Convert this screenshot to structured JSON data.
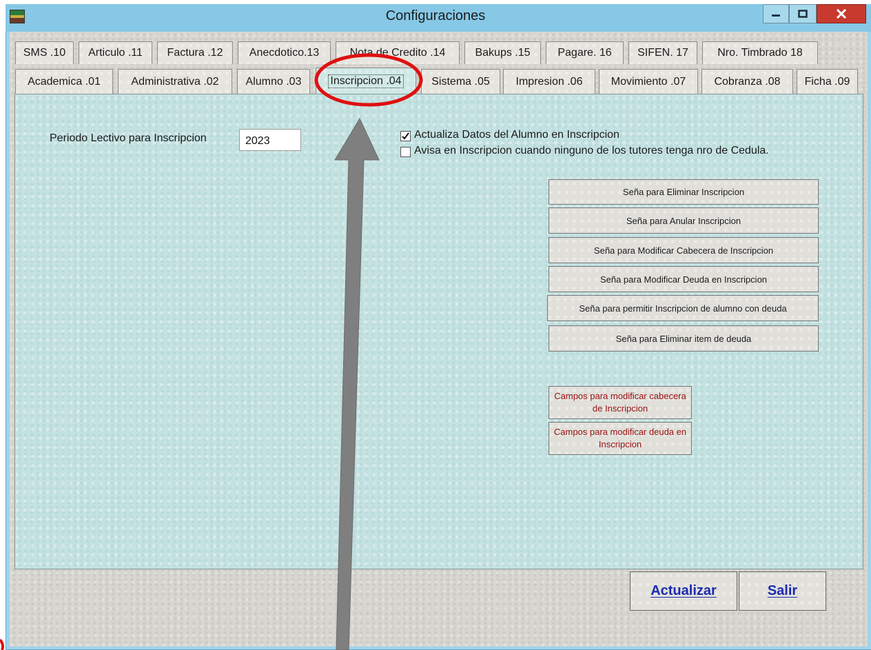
{
  "window": {
    "title": "Configuraciones"
  },
  "tabs_row1": [
    "SMS .10",
    "Articulo .11",
    "Factura .12",
    "Anecdotico.13",
    "Nota de Credito .14",
    "Bakups .15",
    "Pagare. 16",
    "SIFEN. 17",
    "Nro. Timbrado 18"
  ],
  "tabs_row2": [
    "Academica .01",
    "Administrativa .02",
    "Alumno .03",
    "Inscripcion .04",
    "Sistema .05",
    "Impresion .06",
    "Movimiento .07",
    "Cobranza .08",
    "Ficha .09"
  ],
  "active_tab": "Inscripcion .04",
  "inscripcion": {
    "periodo_label": "Periodo Lectivo para Inscripcion",
    "periodo_value": "2023",
    "check1": {
      "label": "Actualiza Datos del Alumno en Inscripcion",
      "checked": true
    },
    "check2": {
      "label": "Avisa en Inscripcion cuando ninguno de los tutores tenga nro de Cedula.",
      "checked": false
    },
    "buttons": [
      "Seña para Eliminar Inscripcion",
      "Seña para Anular Inscripcion",
      "Seña para Modificar Cabecera de Inscripcion",
      "Seña para Modificar Deuda en Inscripcion",
      "Seña para permitir Inscripcion de alumno con deuda",
      "Seña para Eliminar item de deuda"
    ],
    "campos_cabecera": "Campos para modificar cabecera de Inscripcion",
    "campos_deuda": "Campos para modificar deuda en Inscripcion"
  },
  "footer": {
    "actualizar": "Actualizar",
    "salir": "Salir"
  },
  "colors": {
    "titlebar": "#86c8e6",
    "panel": "#c5e2e2",
    "annotation_red": "#e01010",
    "arrow": "#7f7f7f",
    "button_text_blue": "#1c2bb0"
  }
}
